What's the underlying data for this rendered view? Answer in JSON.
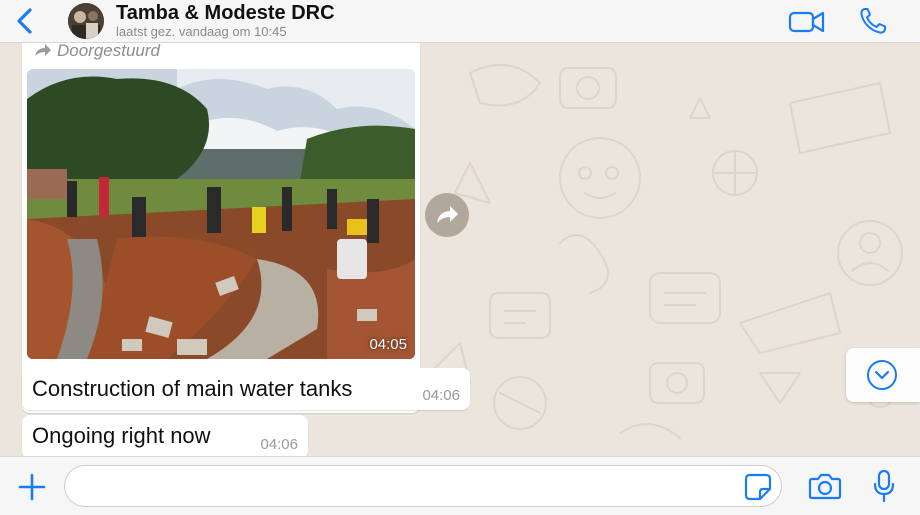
{
  "header": {
    "contact_name": "Tamba & Modeste DRC",
    "last_seen": "laatst gez. vandaag om 10:45"
  },
  "chat": {
    "image_message": {
      "forwarded_label": "Doorgestuurd",
      "time": "04:05"
    },
    "messages": [
      {
        "text": "Construction of main water tanks",
        "time": "04:06"
      },
      {
        "text": "Ongoing right now",
        "time": "04:06"
      }
    ]
  },
  "composer": {
    "placeholder": ""
  },
  "icons": {
    "back": "chevron-left-icon",
    "video": "video-camera-icon",
    "call": "phone-icon",
    "forward": "forward-arrow-icon",
    "share": "share-icon",
    "scroll_down": "chevron-down-icon",
    "attach": "plus-icon",
    "sticker": "sticker-icon",
    "camera": "camera-icon",
    "mic": "microphone-icon"
  },
  "colors": {
    "accent": "#1A7CF5",
    "chat_background": "#ECE5DD",
    "bubble": "#FFFFFF"
  }
}
